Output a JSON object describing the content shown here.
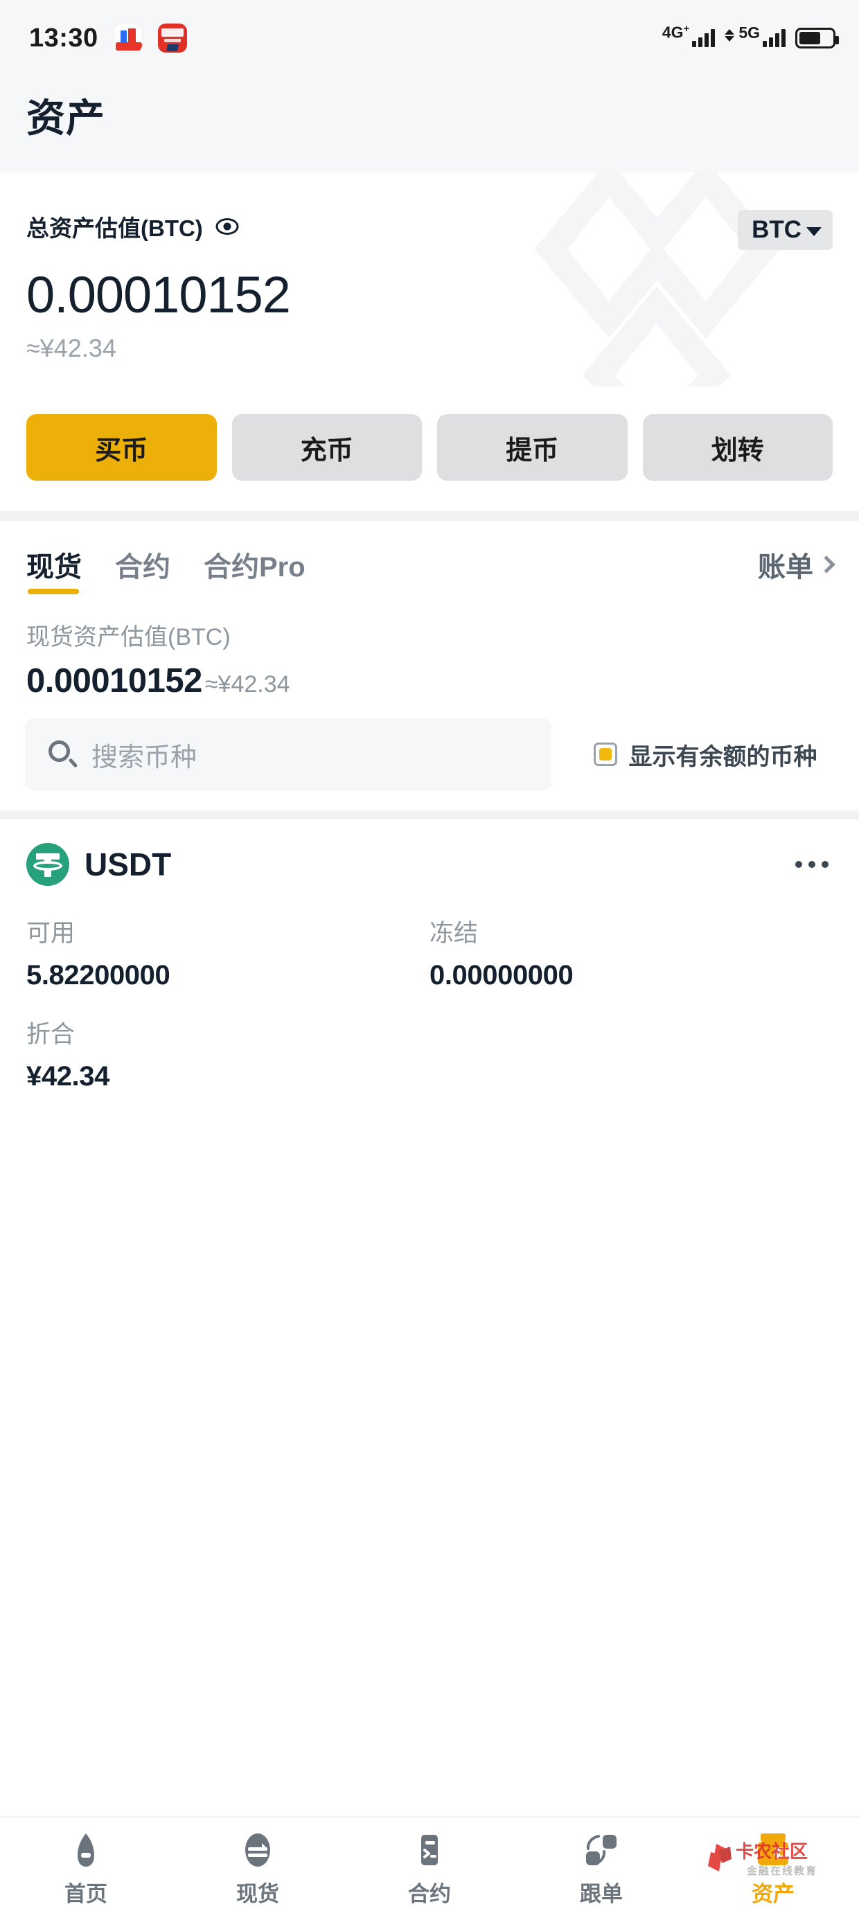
{
  "status_bar": {
    "time": "13:30",
    "app_icons": [
      "shopping-assistant-icon",
      "unionpay-cloudpay-icon"
    ],
    "network_4g": "4G",
    "network_4g_sup": "+",
    "network_5g": "5G",
    "battery_level_pct": 66
  },
  "header": {
    "title": "资产"
  },
  "total_assets": {
    "label": "总资产估值(BTC)",
    "eye_icon": "eye-icon",
    "currency_selector": "BTC",
    "value": "0.00010152",
    "fiat_value": "≈¥42.34"
  },
  "actions": [
    {
      "label": "买币",
      "primary": true
    },
    {
      "label": "充币",
      "primary": false
    },
    {
      "label": "提币",
      "primary": false
    },
    {
      "label": "划转",
      "primary": false
    }
  ],
  "tabs": {
    "items": [
      {
        "label": "现货",
        "active": true
      },
      {
        "label": "合约",
        "active": false
      },
      {
        "label": "合约Pro",
        "active": false
      }
    ],
    "bills_label": "账单"
  },
  "spot": {
    "label": "现货资产估值(BTC)",
    "value": "0.00010152",
    "fiat_value": "≈¥42.34"
  },
  "search": {
    "placeholder": "搜索币种",
    "icon": "search-icon",
    "filter_label": "显示有余额的币种",
    "filter_checked": true
  },
  "coins": [
    {
      "symbol": "USDT",
      "logo": "tether-logo",
      "menu_icon": "more-options-icon",
      "available_label": "可用",
      "available_value": "5.82200000",
      "frozen_label": "冻结",
      "frozen_value": "0.00000000",
      "equivalent_label": "折合",
      "equivalent_value": "¥42.34"
    }
  ],
  "bottom_nav": [
    {
      "label": "首页",
      "icon": "home-icon",
      "active": false
    },
    {
      "label": "现货",
      "icon": "exchange-icon",
      "active": false
    },
    {
      "label": "合约",
      "icon": "contract-icon",
      "active": false
    },
    {
      "label": "跟单",
      "icon": "copytrade-icon",
      "active": false
    },
    {
      "label": "资产",
      "icon": "wallet-icon",
      "active": true
    }
  ],
  "watermark": {
    "brand_text": "卡农社区",
    "brand_sub": "金融在线教育"
  },
  "colors": {
    "accent_yellow": "#edb008",
    "active_yellow": "#f0a80a",
    "text_dark": "#14202e",
    "text_muted": "#8e969e",
    "tether_green": "#26a17b",
    "button_gray": "#dedfe1",
    "bg_gray": "#f6f7f8"
  }
}
